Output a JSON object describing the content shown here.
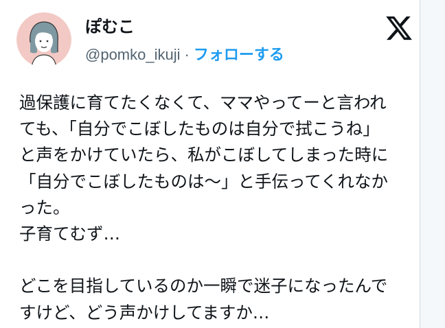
{
  "author": {
    "display_name": "ぽむこ",
    "handle": "@pomko_ikuji",
    "separator": "·",
    "follow_label": "フォローする"
  },
  "brand": {
    "logo_icon": "x-logo-icon"
  },
  "tweet": {
    "lines": [
      "過保護に育てたくなくて、ママやってーと言われ",
      "ても、「自分でこぼしたものは自分で拭こうね」",
      "と声をかけていたら、私がこぼしてしまった時に",
      "「自分でこぼしたものは〜」と手伝ってくれなか",
      "った。",
      "子育てむず…",
      "",
      "どこを目指しているのか一瞬で迷子になったんで",
      "すけど、どう声かけしてますか…"
    ]
  },
  "colors": {
    "text": "#0f1419",
    "secondary": "#536471",
    "accent": "#1d9bf0",
    "avatar_bg": "#f2c9c4"
  }
}
